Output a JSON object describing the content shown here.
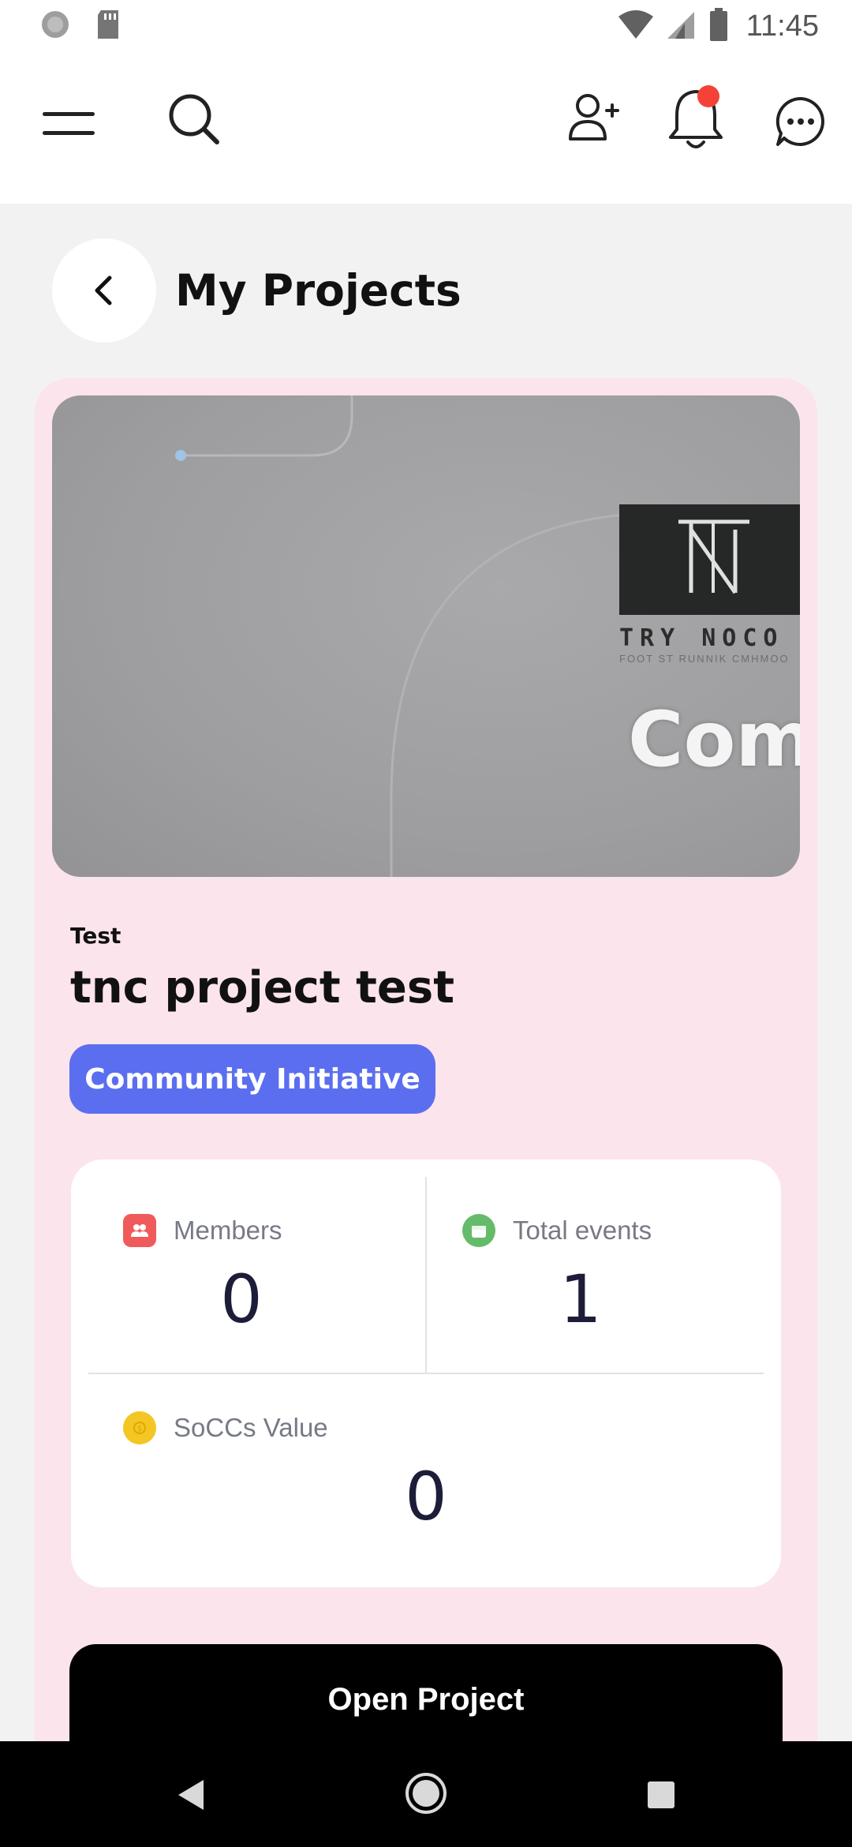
{
  "status_bar": {
    "time": "11:45"
  },
  "app_bar": {
    "icons": [
      "menu-icon",
      "search-icon",
      "add-user-icon",
      "bell-icon",
      "chat-icon"
    ],
    "notification_dot_color": "#f44336"
  },
  "header": {
    "title": "My Projects"
  },
  "project_card": {
    "background_color": "#fce4ec",
    "image": {
      "logo_text": "TRY NOCO",
      "logo_subtext": "FOOT ST RUNNIK CMHMOO",
      "overlay_text": "Com"
    },
    "category": "Test",
    "title": "tnc project test",
    "tag": "Community Initiative",
    "tag_color": "#5b6ef0",
    "stats": {
      "members_label": "Members",
      "members_value": "0",
      "events_label": "Total events",
      "events_value": "1",
      "soccs_label": "SoCCs Value",
      "soccs_value": "0"
    },
    "open_button": "Open Project"
  }
}
